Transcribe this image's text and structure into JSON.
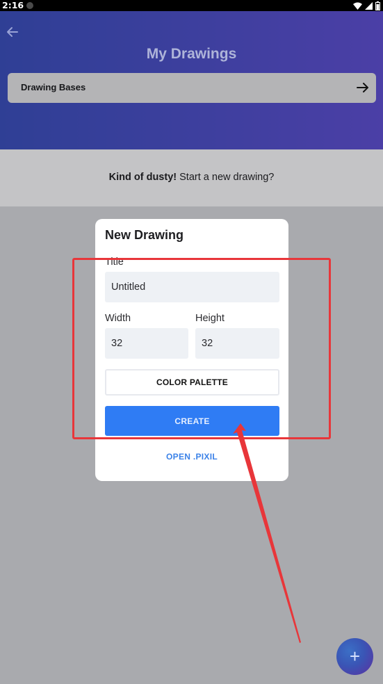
{
  "status_bar": {
    "time": "2:16"
  },
  "header": {
    "title": "My Drawings",
    "bases_label": "Drawing Bases"
  },
  "empty_state": {
    "bold": "Kind of dusty!",
    "rest": " Start a new drawing?"
  },
  "dialog": {
    "title": "New Drawing",
    "title_label": "Title",
    "title_value": "Untitled",
    "width_label": "Width",
    "width_value": "32",
    "height_label": "Height",
    "height_value": "32",
    "palette_label": "COLOR PALETTE",
    "create_label": "CREATE",
    "open_label": "OPEN .PIXIL"
  },
  "fab": {
    "label": "+"
  },
  "colors": {
    "header_start": "#2f3f95",
    "header_end": "#4b3fa6",
    "primary_button": "#2f7cf4",
    "annotation": "#e8363a",
    "scrim": "#a9aaae"
  },
  "icons": [
    "back-arrow-icon",
    "wifi-icon",
    "signal-icon",
    "battery-icon",
    "arrow-right-icon",
    "plus-icon"
  ]
}
